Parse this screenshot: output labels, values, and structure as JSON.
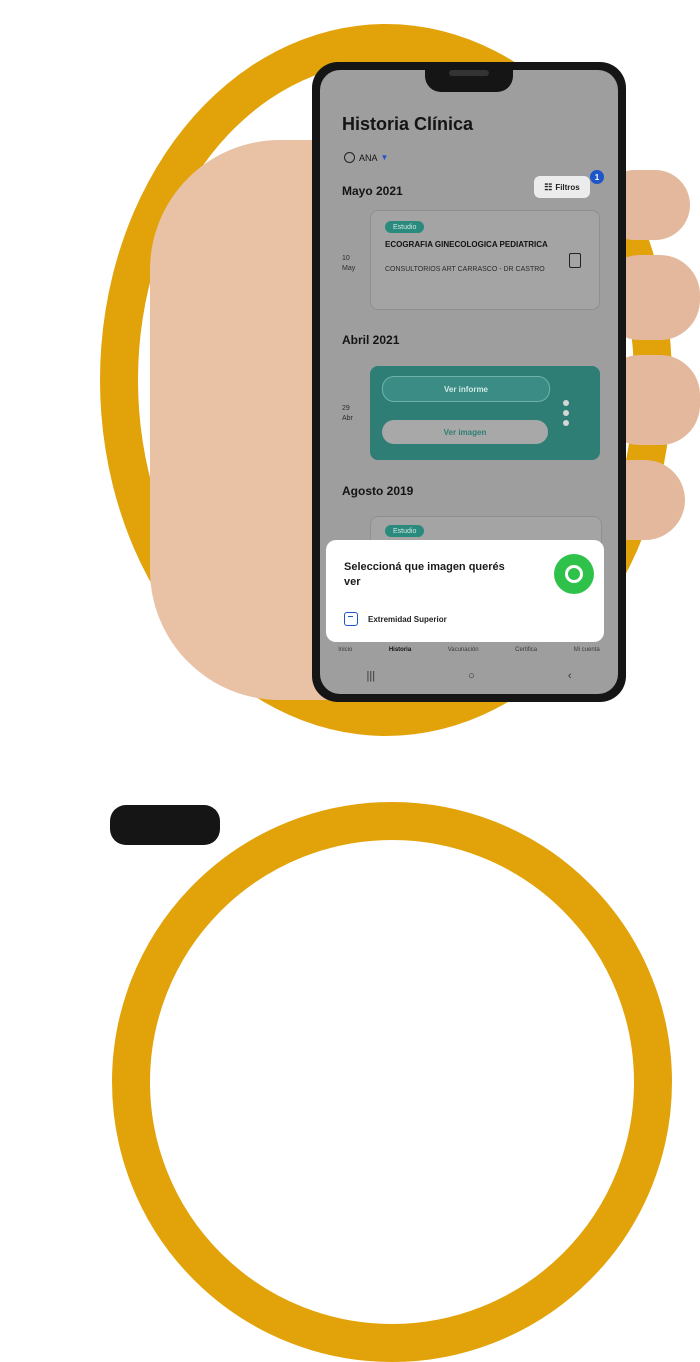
{
  "header": {
    "title": "Historia Clínica",
    "user": "ANA"
  },
  "filter": {
    "label": "Filtros",
    "count": "1"
  },
  "sections": [
    {
      "month": "Mayo 2021",
      "day": "10",
      "mon": "May",
      "chip": "Estudio",
      "title": "ECOGRAFIA GINECOLOGICA PEDIATRICA",
      "subtitle": "CONSULTORIOS ART CARRASCO - DR CASTRO"
    },
    {
      "month": "Abril 2021",
      "day": "29",
      "mon": "Abr",
      "button1": "Ver informe",
      "button2": "Ver imagen"
    },
    {
      "month": "Agosto 2019",
      "chip": "Estudio"
    }
  ],
  "sheet": {
    "title": "Seleccioná que imagen querés ver",
    "option": "Extremidad Superior"
  },
  "bottom_nav": [
    "Inicio",
    "Historia",
    "Vacunación",
    "Certifica",
    "Mi cuenta"
  ],
  "colors": {
    "accent_ring": "#e2a30a",
    "teal": "#2f7e76",
    "blue": "#1e55c8",
    "whatsapp": "#2fc24b"
  }
}
